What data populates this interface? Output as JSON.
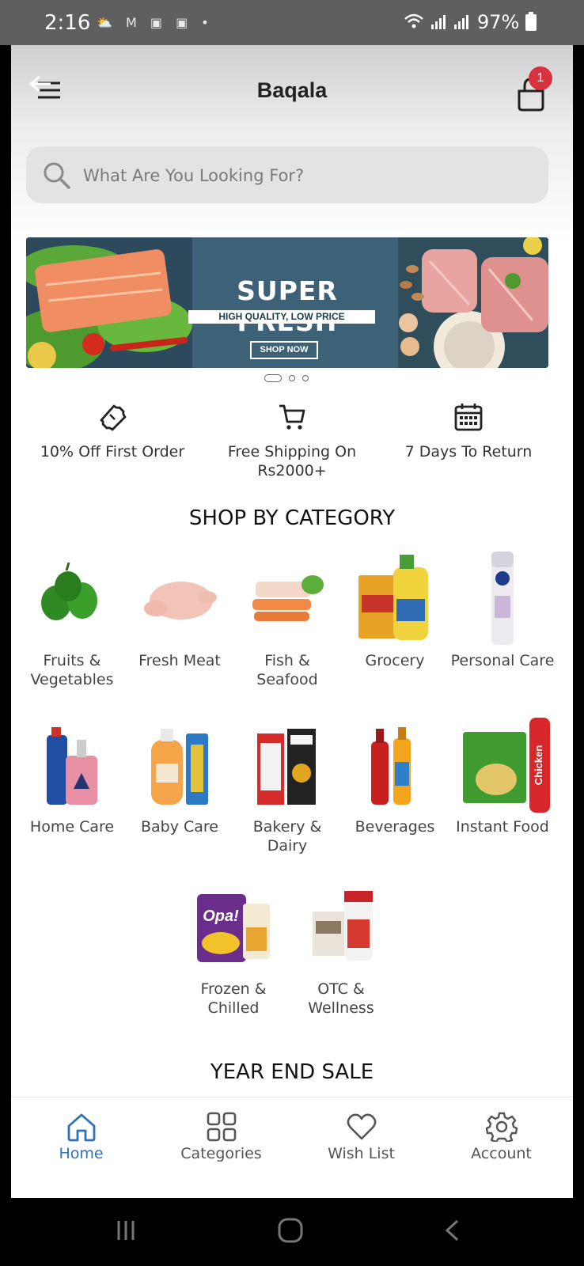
{
  "status_bar": {
    "time": "2:16",
    "notification_icons": "⛅ M ▣ ▣ •",
    "battery": "97%"
  },
  "header": {
    "title": "Baqala",
    "cart_count": "1"
  },
  "search": {
    "placeholder": "What Are You Looking For?"
  },
  "banner": {
    "title": "SUPER FRESH",
    "subtitle": "HIGH QUALITY, LOW PRICE",
    "cta": "SHOP NOW",
    "slide_count": 3,
    "active_slide": 1
  },
  "features": [
    {
      "icon": "ticket-icon",
      "label": "10% Off First Order"
    },
    {
      "icon": "cart-icon",
      "label": "Free Shipping On Rs2000+"
    },
    {
      "icon": "calendar-icon",
      "label": "7 Days To Return"
    }
  ],
  "shop_by_category": {
    "title": "SHOP BY CATEGORY",
    "items": [
      {
        "label": "Fruits & Vegetables"
      },
      {
        "label": "Fresh Meat"
      },
      {
        "label": "Fish & Seafood"
      },
      {
        "label": "Grocery"
      },
      {
        "label": "Personal Care"
      },
      {
        "label": "Home Care"
      },
      {
        "label": "Baby Care"
      },
      {
        "label": "Bakery & Dairy"
      },
      {
        "label": "Beverages"
      },
      {
        "label": "Instant Food"
      },
      {
        "label": "Frozen & Chilled"
      },
      {
        "label": "OTC & Wellness"
      }
    ]
  },
  "year_end_sale": {
    "title": "YEAR END SALE"
  },
  "bottom_nav": {
    "items": [
      {
        "label": "Home",
        "icon": "home-icon",
        "active": true
      },
      {
        "label": "Categories",
        "icon": "grid-icon",
        "active": false
      },
      {
        "label": "Wish List",
        "icon": "heart-icon",
        "active": false
      },
      {
        "label": "Account",
        "icon": "gear-icon",
        "active": false
      }
    ]
  },
  "colors": {
    "accent": "#2f72b8",
    "badge": "#d9323f",
    "banner_bg": "#3b5e73",
    "search_bg": "#e3e3e3"
  }
}
